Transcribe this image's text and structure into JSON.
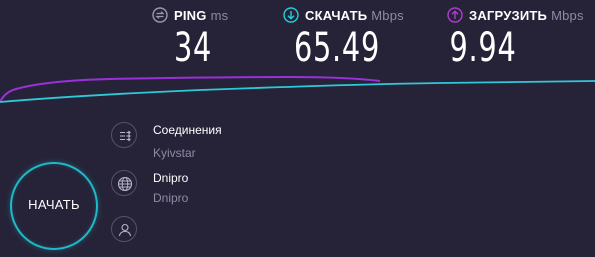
{
  "metrics": {
    "ping": {
      "label": "PING",
      "unit": "ms",
      "value": "34",
      "icon": "ping-icon",
      "color": "#9a97ae"
    },
    "download": {
      "label": "СКАЧАТЬ",
      "unit": "Mbps",
      "value": "65.49",
      "icon": "download-arrow-icon",
      "color": "#1fd1d6"
    },
    "upload": {
      "label": "ЗАГРУЗИТЬ",
      "unit": "Mbps",
      "value": "9.94",
      "icon": "upload-arrow-icon",
      "color": "#b13ad6"
    }
  },
  "graph": {
    "download_color": "#2ec9d8",
    "upload_color": "#9b30d9"
  },
  "start_button": {
    "label": "НАЧАТЬ",
    "color": "#1fb9c8"
  },
  "connection": {
    "title": "Соединения",
    "provider": "Kyivstar",
    "icon": "connections-icon"
  },
  "server": {
    "city": "Dnipro",
    "host": "Dnipro",
    "icon": "globe-icon"
  },
  "user": {
    "icon": "user-icon"
  },
  "colors": {
    "background": "#262338",
    "muted_text": "#8e8aa5"
  }
}
